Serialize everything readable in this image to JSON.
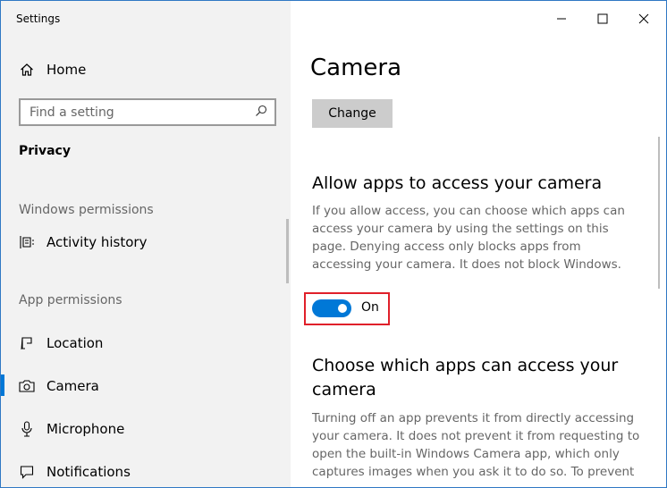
{
  "window": {
    "title": "Settings",
    "controls": {
      "minimize": "minimize-icon",
      "maximize": "maximize-icon",
      "close": "close-icon"
    }
  },
  "sidebar": {
    "home": {
      "label": "Home",
      "icon": "home-icon"
    },
    "search": {
      "placeholder": "Find a setting",
      "value": "",
      "icon": "search-icon"
    },
    "category": "Privacy",
    "sections": [
      {
        "heading": "Windows permissions",
        "items": [
          {
            "label": "Activity history",
            "icon": "activity-history-icon"
          }
        ]
      },
      {
        "heading": "App permissions",
        "items": [
          {
            "label": "Location",
            "icon": "location-icon"
          },
          {
            "label": "Camera",
            "icon": "camera-icon",
            "selected": true
          },
          {
            "label": "Microphone",
            "icon": "microphone-icon"
          },
          {
            "label": "Notifications",
            "icon": "notifications-icon"
          }
        ]
      }
    ],
    "accent_color": "#0078d7"
  },
  "main": {
    "title": "Camera",
    "change_button": "Change",
    "allow_section": {
      "heading": "Allow apps to access your camera",
      "description": "If you allow access, you can choose which apps can access your camera by using the settings on this page. Denying access only blocks apps from accessing your camera. It does not block Windows.",
      "toggle": {
        "state": "On",
        "is_on": true,
        "color": "#0078d7"
      },
      "highlight_color": "#e0202a"
    },
    "choose_section": {
      "heading": "Choose which apps can access your camera",
      "description": "Turning off an app prevents it from directly accessing your camera. It does not prevent it from requesting to open the built-in Windows Camera app, which only captures images when you ask it to do so. To prevent"
    }
  }
}
